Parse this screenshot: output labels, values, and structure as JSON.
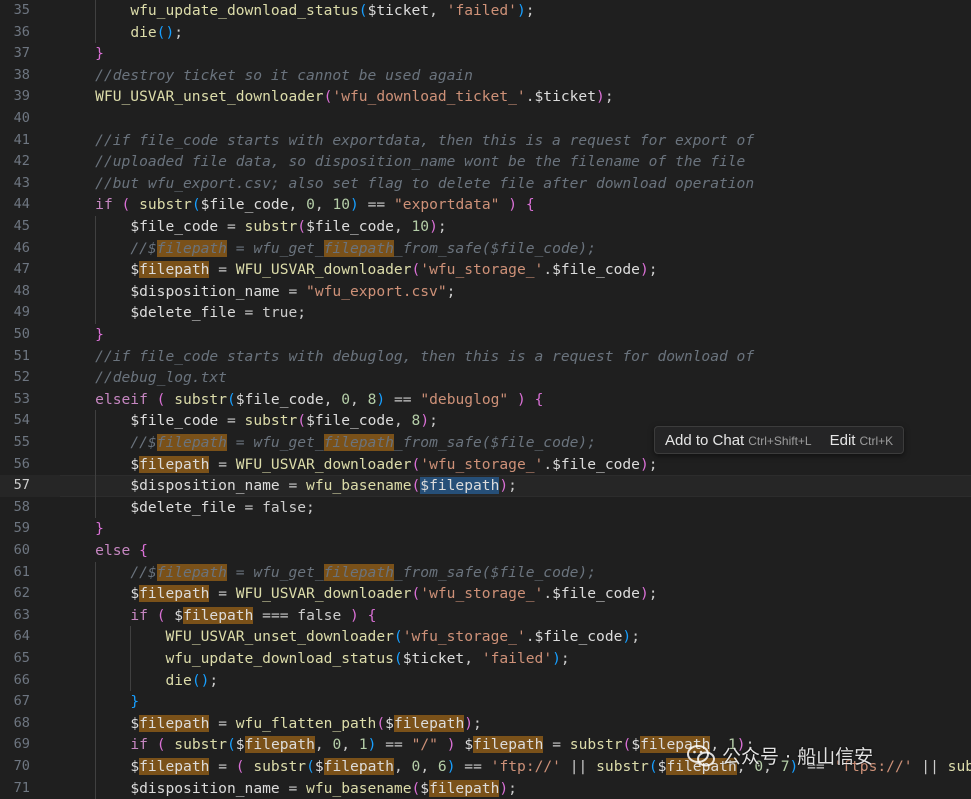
{
  "editor": {
    "first_line_number": 35,
    "current_line": 57,
    "lines": [
      {
        "indent": 2,
        "tokens": [
          [
            "fn",
            "wfu_update_download_status"
          ],
          [
            "b3",
            "("
          ],
          [
            "var",
            "$ticket"
          ],
          [
            "plain",
            ", "
          ],
          [
            "str",
            "'failed'"
          ],
          [
            "b3",
            ")"
          ],
          [
            "plain",
            ";"
          ]
        ]
      },
      {
        "indent": 2,
        "tokens": [
          [
            "fn",
            "die"
          ],
          [
            "b3",
            "()"
          ],
          [
            "plain",
            ";"
          ]
        ]
      },
      {
        "indent": 1,
        "tokens": [
          [
            "b2",
            "}"
          ]
        ]
      },
      {
        "indent": 1,
        "tokens": [
          [
            "cm",
            "//destroy ticket so it cannot be used again"
          ]
        ]
      },
      {
        "indent": 1,
        "tokens": [
          [
            "fn",
            "WFU_USVAR_unset_downloader"
          ],
          [
            "b2",
            "("
          ],
          [
            "str",
            "'wfu_download_ticket_'"
          ],
          [
            "plain",
            "."
          ],
          [
            "var",
            "$ticket"
          ],
          [
            "b2",
            ")"
          ],
          [
            "plain",
            ";"
          ]
        ]
      },
      {
        "indent": 0,
        "tokens": []
      },
      {
        "indent": 1,
        "tokens": [
          [
            "cm",
            "//if file_code starts with exportdata, then this is a request for export of"
          ]
        ]
      },
      {
        "indent": 1,
        "tokens": [
          [
            "cm",
            "//uploaded file data, so disposition_name wont be the filename of the file"
          ]
        ]
      },
      {
        "indent": 1,
        "tokens": [
          [
            "cm",
            "//but wfu_export.csv; also set flag to delete file after download operation"
          ]
        ]
      },
      {
        "indent": 1,
        "tokens": [
          [
            "kw",
            "if"
          ],
          [
            "plain",
            " "
          ],
          [
            "b2",
            "("
          ],
          [
            "plain",
            " "
          ],
          [
            "fn",
            "substr"
          ],
          [
            "b3",
            "("
          ],
          [
            "var",
            "$file_code"
          ],
          [
            "plain",
            ", "
          ],
          [
            "num",
            "0"
          ],
          [
            "plain",
            ", "
          ],
          [
            "num",
            "10"
          ],
          [
            "b3",
            ")"
          ],
          [
            "plain",
            " == "
          ],
          [
            "str",
            "\"exportdata\""
          ],
          [
            "plain",
            " "
          ],
          [
            "b2",
            ")"
          ],
          [
            "plain",
            " "
          ],
          [
            "b2",
            "{"
          ]
        ]
      },
      {
        "indent": 2,
        "tokens": [
          [
            "var",
            "$file_code"
          ],
          [
            "plain",
            " = "
          ],
          [
            "fn",
            "substr"
          ],
          [
            "b2",
            "("
          ],
          [
            "var",
            "$file_code"
          ],
          [
            "plain",
            ", "
          ],
          [
            "num",
            "10"
          ],
          [
            "b2",
            ")"
          ],
          [
            "plain",
            ";"
          ]
        ]
      },
      {
        "indent": 2,
        "tokens": [
          [
            "cm",
            "//$"
          ],
          [
            "cm-hl",
            "filepath"
          ],
          [
            "cm",
            " = wfu_get_"
          ],
          [
            "cm-hl",
            "filepath"
          ],
          [
            "cm",
            "_from_safe($file_code);"
          ]
        ]
      },
      {
        "indent": 2,
        "tokens": [
          [
            "var",
            "$"
          ],
          [
            "var-hl",
            "filepath"
          ],
          [
            "plain",
            " = "
          ],
          [
            "fn",
            "WFU_USVAR_downloader"
          ],
          [
            "b2",
            "("
          ],
          [
            "str",
            "'wfu_storage_'"
          ],
          [
            "plain",
            "."
          ],
          [
            "var",
            "$file_code"
          ],
          [
            "b2",
            ")"
          ],
          [
            "plain",
            ";"
          ]
        ]
      },
      {
        "indent": 2,
        "tokens": [
          [
            "var",
            "$disposition_name"
          ],
          [
            "plain",
            " = "
          ],
          [
            "str",
            "\"wfu_export.csv\""
          ],
          [
            "plain",
            ";"
          ]
        ]
      },
      {
        "indent": 2,
        "tokens": [
          [
            "var",
            "$delete_file"
          ],
          [
            "plain",
            " = true;"
          ]
        ]
      },
      {
        "indent": 1,
        "tokens": [
          [
            "b2",
            "}"
          ]
        ]
      },
      {
        "indent": 1,
        "tokens": [
          [
            "cm",
            "//if file_code starts with debuglog, then this is a request for download of"
          ]
        ]
      },
      {
        "indent": 1,
        "tokens": [
          [
            "cm",
            "//debug_log.txt"
          ]
        ]
      },
      {
        "indent": 1,
        "tokens": [
          [
            "kw",
            "elseif"
          ],
          [
            "plain",
            " "
          ],
          [
            "b2",
            "("
          ],
          [
            "plain",
            " "
          ],
          [
            "fn",
            "substr"
          ],
          [
            "b3",
            "("
          ],
          [
            "var",
            "$file_code"
          ],
          [
            "plain",
            ", "
          ],
          [
            "num",
            "0"
          ],
          [
            "plain",
            ", "
          ],
          [
            "num",
            "8"
          ],
          [
            "b3",
            ")"
          ],
          [
            "plain",
            " == "
          ],
          [
            "str",
            "\"debuglog\""
          ],
          [
            "plain",
            " "
          ],
          [
            "b2",
            ")"
          ],
          [
            "plain",
            " "
          ],
          [
            "b2",
            "{"
          ]
        ]
      },
      {
        "indent": 2,
        "tokens": [
          [
            "var",
            "$file_code"
          ],
          [
            "plain",
            " = "
          ],
          [
            "fn",
            "substr"
          ],
          [
            "b2",
            "("
          ],
          [
            "var",
            "$file_code"
          ],
          [
            "plain",
            ", "
          ],
          [
            "num",
            "8"
          ],
          [
            "b2",
            ")"
          ],
          [
            "plain",
            ";"
          ]
        ]
      },
      {
        "indent": 2,
        "tokens": [
          [
            "cm",
            "//$"
          ],
          [
            "cm-hl",
            "filepath"
          ],
          [
            "cm",
            " = wfu_get_"
          ],
          [
            "cm-hl",
            "filepath"
          ],
          [
            "cm",
            "_from_safe($file_code);"
          ]
        ]
      },
      {
        "indent": 2,
        "tokens": [
          [
            "var",
            "$"
          ],
          [
            "var-hl",
            "filepath"
          ],
          [
            "plain",
            " = "
          ],
          [
            "fn",
            "WFU_USVAR_downloader"
          ],
          [
            "b2",
            "("
          ],
          [
            "str",
            "'wfu_storage_'"
          ],
          [
            "plain",
            "."
          ],
          [
            "var",
            "$file_code"
          ],
          [
            "b2",
            ")"
          ],
          [
            "plain",
            ";"
          ]
        ]
      },
      {
        "indent": 2,
        "tokens": [
          [
            "var",
            "$disposition_name"
          ],
          [
            "plain",
            " = "
          ],
          [
            "fn",
            "wfu_basename"
          ],
          [
            "b2",
            "("
          ],
          [
            "var-sel",
            "$filepath"
          ],
          [
            "b2",
            ")"
          ],
          [
            "plain",
            ";"
          ]
        ]
      },
      {
        "indent": 2,
        "tokens": [
          [
            "var",
            "$delete_file"
          ],
          [
            "plain",
            " = false;"
          ]
        ]
      },
      {
        "indent": 1,
        "tokens": [
          [
            "b2",
            "}"
          ]
        ]
      },
      {
        "indent": 1,
        "tokens": [
          [
            "kw",
            "else"
          ],
          [
            "plain",
            " "
          ],
          [
            "b2",
            "{"
          ]
        ]
      },
      {
        "indent": 2,
        "tokens": [
          [
            "cm",
            "//$"
          ],
          [
            "cm-hl",
            "filepath"
          ],
          [
            "cm",
            " = wfu_get_"
          ],
          [
            "cm-hl",
            "filepath"
          ],
          [
            "cm",
            "_from_safe($file_code);"
          ]
        ]
      },
      {
        "indent": 2,
        "tokens": [
          [
            "var",
            "$"
          ],
          [
            "var-hl",
            "filepath"
          ],
          [
            "plain",
            " = "
          ],
          [
            "fn",
            "WFU_USVAR_downloader"
          ],
          [
            "b2",
            "("
          ],
          [
            "str",
            "'wfu_storage_'"
          ],
          [
            "plain",
            "."
          ],
          [
            "var",
            "$file_code"
          ],
          [
            "b2",
            ")"
          ],
          [
            "plain",
            ";"
          ]
        ]
      },
      {
        "indent": 2,
        "tokens": [
          [
            "kw",
            "if"
          ],
          [
            "plain",
            " "
          ],
          [
            "b2",
            "("
          ],
          [
            "plain",
            " "
          ],
          [
            "var",
            "$"
          ],
          [
            "var-hl",
            "filepath"
          ],
          [
            "plain",
            " === false "
          ],
          [
            "b2",
            ")"
          ],
          [
            "plain",
            " "
          ],
          [
            "b2",
            "{"
          ]
        ]
      },
      {
        "indent": 3,
        "tokens": [
          [
            "fn",
            "WFU_USVAR_unset_downloader"
          ],
          [
            "b3",
            "("
          ],
          [
            "str",
            "'wfu_storage_'"
          ],
          [
            "plain",
            "."
          ],
          [
            "var",
            "$file_code"
          ],
          [
            "b3",
            ")"
          ],
          [
            "plain",
            ";"
          ]
        ]
      },
      {
        "indent": 3,
        "tokens": [
          [
            "fn",
            "wfu_update_download_status"
          ],
          [
            "b3",
            "("
          ],
          [
            "var",
            "$ticket"
          ],
          [
            "plain",
            ", "
          ],
          [
            "str",
            "'failed'"
          ],
          [
            "b3",
            ")"
          ],
          [
            "plain",
            ";"
          ]
        ]
      },
      {
        "indent": 3,
        "tokens": [
          [
            "fn",
            "die"
          ],
          [
            "b3",
            "()"
          ],
          [
            "plain",
            ";"
          ]
        ]
      },
      {
        "indent": 2,
        "tokens": [
          [
            "b3",
            "}"
          ]
        ]
      },
      {
        "indent": 2,
        "tokens": [
          [
            "var",
            "$"
          ],
          [
            "var-hl",
            "filepath"
          ],
          [
            "plain",
            " = "
          ],
          [
            "fn",
            "wfu_flatten_path"
          ],
          [
            "b2",
            "("
          ],
          [
            "var",
            "$"
          ],
          [
            "var-hl",
            "filepath"
          ],
          [
            "b2",
            ")"
          ],
          [
            "plain",
            ";"
          ]
        ]
      },
      {
        "indent": 2,
        "tokens": [
          [
            "kw",
            "if"
          ],
          [
            "plain",
            " "
          ],
          [
            "b2",
            "("
          ],
          [
            "plain",
            " "
          ],
          [
            "fn",
            "substr"
          ],
          [
            "b3",
            "("
          ],
          [
            "var",
            "$"
          ],
          [
            "var-hl",
            "filepath"
          ],
          [
            "plain",
            ", "
          ],
          [
            "num",
            "0"
          ],
          [
            "plain",
            ", "
          ],
          [
            "num",
            "1"
          ],
          [
            "b3",
            ")"
          ],
          [
            "plain",
            " == "
          ],
          [
            "str",
            "\"/\""
          ],
          [
            "plain",
            " "
          ],
          [
            "b2",
            ")"
          ],
          [
            "plain",
            " "
          ],
          [
            "var",
            "$"
          ],
          [
            "var-hl",
            "filepath"
          ],
          [
            "plain",
            " = "
          ],
          [
            "fn",
            "substr"
          ],
          [
            "b2",
            "("
          ],
          [
            "var",
            "$"
          ],
          [
            "var-hl",
            "filepath"
          ],
          [
            "plain",
            ", "
          ],
          [
            "num",
            "1"
          ],
          [
            "b2",
            ")"
          ],
          [
            "plain",
            ";"
          ]
        ]
      },
      {
        "indent": 2,
        "tokens": [
          [
            "var",
            "$"
          ],
          [
            "var-hl",
            "filepath"
          ],
          [
            "plain",
            " = "
          ],
          [
            "b2",
            "("
          ],
          [
            "plain",
            " "
          ],
          [
            "fn",
            "substr"
          ],
          [
            "b3",
            "("
          ],
          [
            "var",
            "$"
          ],
          [
            "var-hl",
            "filepath"
          ],
          [
            "plain",
            ", "
          ],
          [
            "num",
            "0"
          ],
          [
            "plain",
            ", "
          ],
          [
            "num",
            "6"
          ],
          [
            "b3",
            ")"
          ],
          [
            "plain",
            " == "
          ],
          [
            "str",
            "'ftp://'"
          ],
          [
            "plain",
            " || "
          ],
          [
            "fn",
            "substr"
          ],
          [
            "b3",
            "("
          ],
          [
            "var",
            "$"
          ],
          [
            "var-hl",
            "filepath"
          ],
          [
            "plain",
            ", "
          ],
          [
            "num",
            "0"
          ],
          [
            "plain",
            ", "
          ],
          [
            "num",
            "7"
          ],
          [
            "b3",
            ")"
          ],
          [
            "plain",
            " == "
          ],
          [
            "str",
            "'ftps://'"
          ],
          [
            "plain",
            " || "
          ],
          [
            "fn",
            "sub"
          ]
        ]
      },
      {
        "indent": 2,
        "tokens": [
          [
            "var",
            "$disposition_name"
          ],
          [
            "plain",
            " = "
          ],
          [
            "fn",
            "wfu_basename"
          ],
          [
            "b2",
            "("
          ],
          [
            "var",
            "$"
          ],
          [
            "var-hl",
            "filepath"
          ],
          [
            "b2",
            ")"
          ],
          [
            "plain",
            ";"
          ]
        ]
      }
    ]
  },
  "hint": {
    "add_to_chat": "Add to Chat",
    "add_to_chat_key": "Ctrl+Shift+L",
    "edit": "Edit",
    "edit_key": "Ctrl+K"
  },
  "watermark": {
    "text": "公众号 · 船山信安",
    "icon": "wechat-icon"
  }
}
